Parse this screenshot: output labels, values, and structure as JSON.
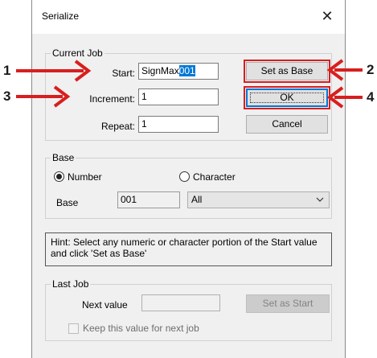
{
  "window": {
    "title": "Serialize",
    "close_glyph": "✕"
  },
  "current_job": {
    "legend": "Current Job",
    "start_label": "Start:",
    "start_value_prefix": "SignMax",
    "start_value_selected": "001",
    "increment_label": "Increment:",
    "increment_value": "1",
    "repeat_label": "Repeat:",
    "repeat_value": "1"
  },
  "buttons": {
    "set_as_base": "Set as Base",
    "ok": "OK",
    "cancel": "Cancel",
    "set_as_start": "Set as Start"
  },
  "base": {
    "legend": "Base",
    "number_option": "Number",
    "character_option": "Character",
    "selected_option": "Number",
    "base_label": "Base",
    "base_value": "001",
    "dropdown_value": "All"
  },
  "hint": {
    "text": "Hint: Select any numeric or character portion of the Start value and click 'Set as Base'"
  },
  "last_job": {
    "legend": "Last Job",
    "next_value_label": "Next value",
    "next_value": "",
    "keep_label": "Keep this value for next job",
    "keep_checked": false
  },
  "callouts": [
    "1",
    "2",
    "3",
    "4"
  ],
  "colors": {
    "callout_arrow": "#d81e1e",
    "accent": "#0078d7",
    "dialog_bg": "#f0f0f0"
  }
}
